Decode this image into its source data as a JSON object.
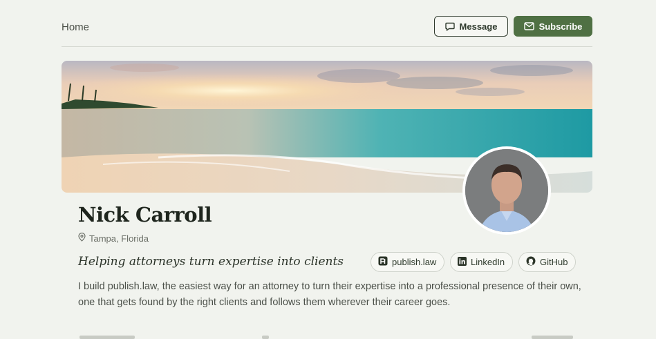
{
  "nav": {
    "home_label": "Home"
  },
  "actions": {
    "message_label": "Message",
    "subscribe_label": "Subscribe"
  },
  "profile": {
    "name": "Nick Carroll",
    "location": "Tampa, Florida",
    "tagline": "Helping attorneys turn expertise into clients",
    "bio": "I build publish.law, the easiest way for an attorney to turn their expertise into a professional presence of their own, one that gets found by the right clients and follows them wherever their career goes."
  },
  "links": [
    {
      "label": "publish.law",
      "icon": "publish-law-icon"
    },
    {
      "label": "LinkedIn",
      "icon": "linkedin-icon"
    },
    {
      "label": "GitHub",
      "icon": "github-icon"
    }
  ],
  "colors": {
    "background": "#f1f3ee",
    "accent": "#4f7043",
    "text": "#2e3a2c"
  },
  "icons": {
    "message": "chat-bubble-icon",
    "subscribe": "envelope-icon",
    "location": "map-pin-icon"
  }
}
